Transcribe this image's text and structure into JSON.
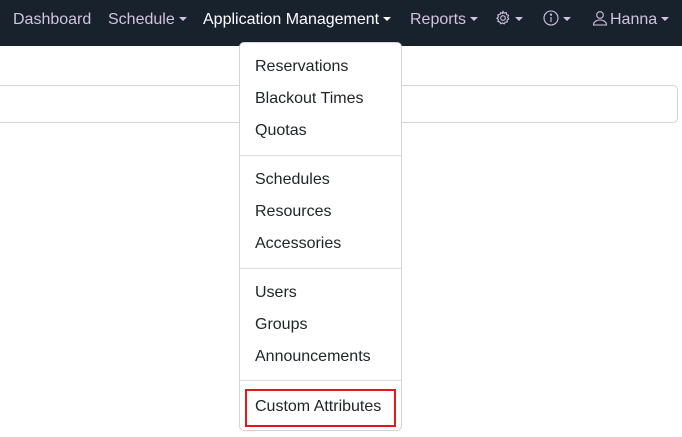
{
  "navbar": {
    "items": [
      {
        "label": "Dashboard",
        "has_caret": false
      },
      {
        "label": "Schedule",
        "has_caret": true
      },
      {
        "label": "Application Management",
        "has_caret": true,
        "active": true
      },
      {
        "label": "Reports",
        "has_caret": true
      },
      {
        "icon": "gear-icon",
        "has_caret": true
      },
      {
        "icon": "info-icon",
        "has_caret": true
      },
      {
        "label": "Hanna",
        "icon": "user-icon",
        "has_caret": true
      }
    ],
    "colors": {
      "background": "#17222c",
      "text": "#d3c3dc",
      "active": "#ffffff"
    }
  },
  "search": {
    "value": ""
  },
  "dropdown": {
    "groups": [
      [
        "Reservations",
        "Blackout Times",
        "Quotas"
      ],
      [
        "Schedules",
        "Resources",
        "Accessories"
      ],
      [
        "Users",
        "Groups",
        "Announcements"
      ],
      [
        "Custom Attributes"
      ]
    ],
    "highlighted": "Custom Attributes",
    "highlight_color": "#e8161b"
  }
}
